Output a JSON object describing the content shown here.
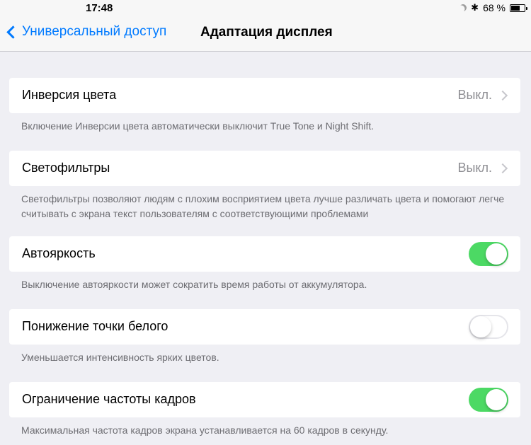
{
  "status_bar": {
    "time": "17:48",
    "battery_text": "68 %",
    "battery_level": 0.68,
    "icons": [
      "moon-icon",
      "bluetooth-icon",
      "battery-icon"
    ]
  },
  "nav": {
    "back_label": "Универсальный доступ",
    "title": "Адаптация дисплея",
    "accent": "#007aff"
  },
  "rows": [
    {
      "label": "Инверсия цвета",
      "value": "Выкл.",
      "footer": "Включение Инверсии цвета автоматически выключит True Tone и Night Shift."
    },
    {
      "label": "Светофильтры",
      "value": "Выкл.",
      "footer": "Светофильтры позволяют людям с плохим восприятием цвета лучше различать цвета и помогают легче считывать с экрана текст пользователям с соответствующими проблемами"
    },
    {
      "label": "Автояркость",
      "toggle": true,
      "footer": "Выключение автояркости может сократить время работы от аккумулятора."
    },
    {
      "label": "Понижение точки белого",
      "toggle": false,
      "footer": "Уменьшается интенсивность ярких цветов."
    },
    {
      "label": "Ограничение частоты кадров",
      "toggle": true,
      "footer": "Максимальная частота кадров экрана устанавливается на 60 кадров в секунду."
    }
  ],
  "colors": {
    "toggle_on": "#4cd964",
    "background": "#efeff4"
  }
}
